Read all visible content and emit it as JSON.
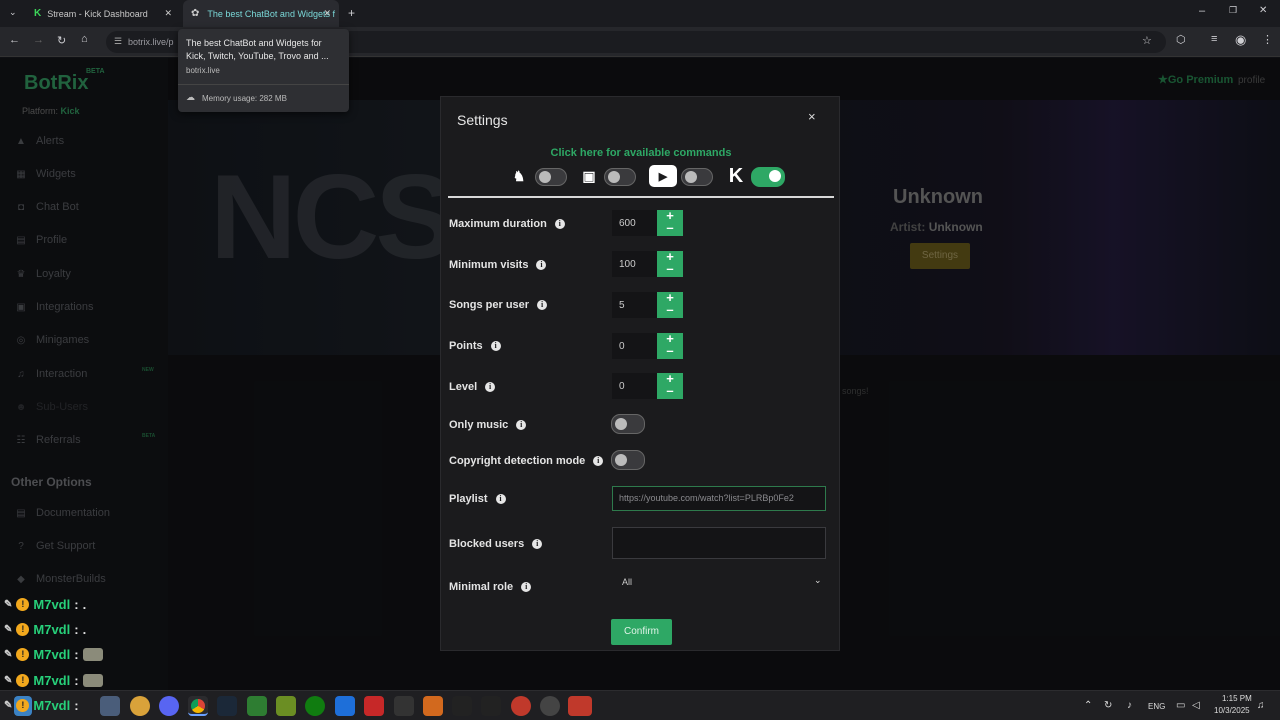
{
  "browser": {
    "tabs": [
      {
        "label": "Stream - Kick Dashboard"
      },
      {
        "label": "The best ChatBot and Widgets f"
      }
    ],
    "url": "botrix.live/p",
    "tooltip": {
      "title": "The best ChatBot and Widgets for Kick, Twitch, YouTube, Trovo and ...",
      "domain": "botrix.live",
      "memory": "Memory usage: 282 MB"
    }
  },
  "sidebar": {
    "logo": "BotRix",
    "beta": "BETA",
    "platform_label": "Platform:",
    "platform_value": "Kick",
    "items": [
      {
        "label": "Alerts",
        "icon": "warning-icon"
      },
      {
        "label": "Widgets",
        "icon": "grid-icon"
      },
      {
        "label": "Chat Bot",
        "icon": "robot-icon"
      },
      {
        "label": "Profile",
        "icon": "profile-card-icon"
      },
      {
        "label": "Loyalty",
        "icon": "trophy-icon"
      },
      {
        "label": "Integrations",
        "icon": "integration-icon"
      },
      {
        "label": "Minigames",
        "icon": "gamepad-icon"
      },
      {
        "label": "Interaction",
        "icon": "music-icon",
        "badge": "NEW"
      },
      {
        "label": "Sub-Users",
        "icon": "users-icon"
      },
      {
        "label": "Referrals",
        "icon": "referrals-icon",
        "badge": "BETA"
      }
    ],
    "other_options": "Other Options",
    "other_items": [
      {
        "label": "Documentation",
        "icon": "docs-icon"
      },
      {
        "label": "Get Support",
        "icon": "help-icon"
      },
      {
        "label": "MonsterBuilds",
        "icon": "monster-icon"
      }
    ]
  },
  "header": {
    "go_premium": "Go Premium",
    "profile": "profile"
  },
  "hero": {
    "song_title": "Unknown",
    "artist_label": "Artist:",
    "artist": "Unknown",
    "settings_button": "Settings",
    "songs_text": "songs!"
  },
  "modal": {
    "title": "Settings",
    "close": "×",
    "commands_link": "Click here for available commands",
    "platforms": [
      {
        "name": "trovo",
        "enabled": false
      },
      {
        "name": "twitch",
        "enabled": false
      },
      {
        "name": "youtube",
        "enabled": false
      },
      {
        "name": "kick",
        "enabled": true
      }
    ],
    "fields": {
      "max_duration": {
        "label": "Maximum duration",
        "value": "600"
      },
      "min_visits": {
        "label": "Minimum visits",
        "value": "100"
      },
      "songs_per_user": {
        "label": "Songs per user",
        "value": "5"
      },
      "points": {
        "label": "Points",
        "value": "0"
      },
      "level": {
        "label": "Level",
        "value": "0"
      },
      "only_music": {
        "label": "Only music",
        "enabled": false
      },
      "copyright_mode": {
        "label": "Copyright detection mode",
        "enabled": false
      },
      "playlist": {
        "label": "Playlist",
        "value": "https://youtube.com/watch?list=PLRBp0Fe2"
      },
      "blocked_users": {
        "label": "Blocked users",
        "value": ""
      },
      "minimal_role": {
        "label": "Minimal role",
        "value": "All"
      }
    },
    "confirm": "Confirm",
    "accent": "#2ea865"
  },
  "chat": [
    {
      "user": "M7vdl",
      "sep": ":",
      "message": "."
    },
    {
      "user": "M7vdl",
      "sep": ":",
      "message": "."
    },
    {
      "user": "M7vdl",
      "sep": ":",
      "message": ""
    },
    {
      "user": "M7vdl",
      "sep": ":",
      "message": ""
    },
    {
      "user": "M7vdl",
      "sep": ":",
      "message": ""
    }
  ],
  "taskbar": {
    "language": "ENG",
    "time": "1:15 PM",
    "date": "10/3/2025"
  }
}
